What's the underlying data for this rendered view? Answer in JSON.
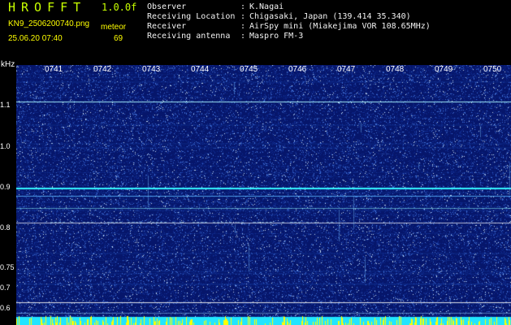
{
  "header": {
    "brand": "HROFFT",
    "version": "1.0.0f",
    "file_name": "KN9_2506200740.png",
    "timestamp": "25.06.20 07:40",
    "meteor_label": "meteor",
    "meteor_count": "69"
  },
  "info": {
    "rows": [
      {
        "label": "Observer",
        "sep": ":",
        "value": "K.Nagai"
      },
      {
        "label": "Receiving Location",
        "sep": ":",
        "value": "Chigasaki, Japan (139.414 35.340)"
      },
      {
        "label": "Receiver",
        "sep": ":",
        "value": "AirSpy mini (Miakejima VOR 108.65MHz)"
      },
      {
        "label": "Receiving antenna",
        "sep": ":",
        "value": "Maspro FM-3"
      }
    ]
  },
  "axis": {
    "unit": "kHz",
    "time_labels": [
      "0741",
      "0742",
      "0743",
      "0744",
      "0745",
      "0746",
      "0747",
      "0748",
      "0749",
      "0750"
    ],
    "freq_labels": [
      "1.1",
      "1.0",
      "0.9",
      "0.8",
      "0.75",
      "0.7",
      "0.6"
    ]
  },
  "colors": {
    "background": "#000000",
    "spectrogram_base": "#06166b",
    "spectrogram_mid": "#1d40b0",
    "spectrogram_high": "#4d8cff",
    "highlight": "#ffff00",
    "cyan": "#21e5ff",
    "brand": "#c8ff00"
  }
}
